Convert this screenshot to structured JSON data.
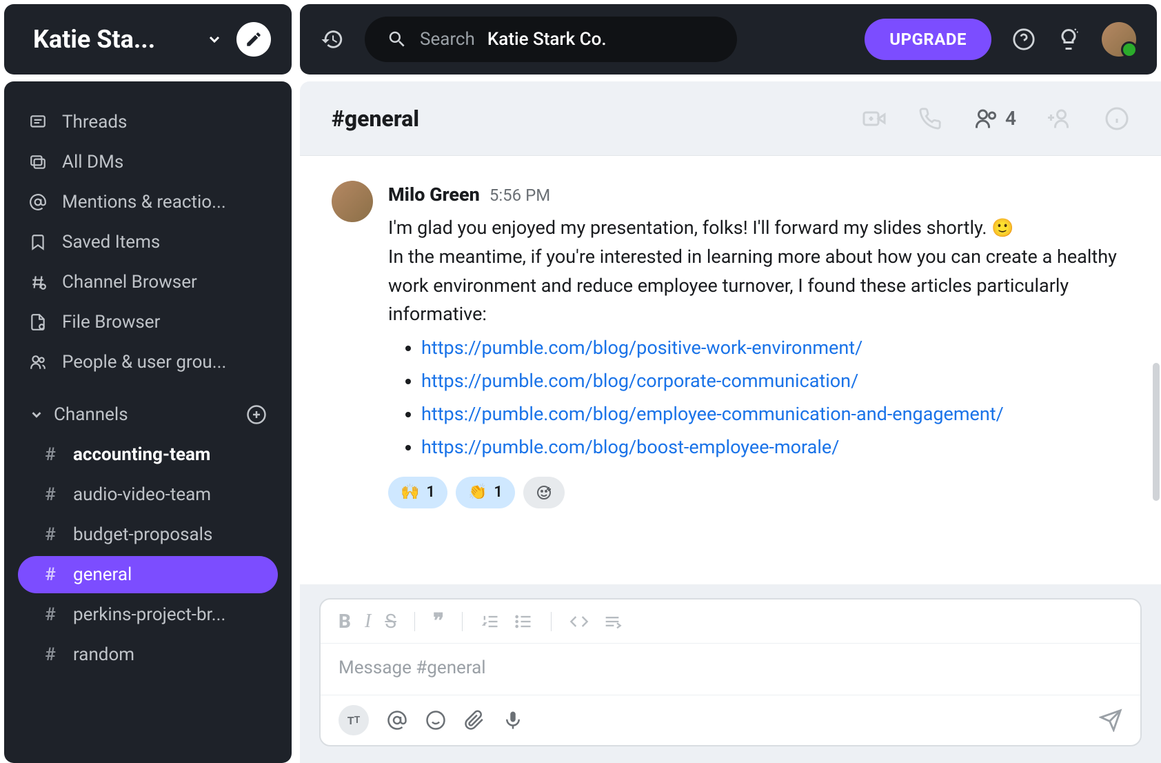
{
  "workspace": {
    "name": "Katie Sta..."
  },
  "search": {
    "label": "Search",
    "value": "Katie Stark Co."
  },
  "header": {
    "upgrade": "UPGRADE"
  },
  "nav": {
    "threads": "Threads",
    "dms": "All DMs",
    "mentions": "Mentions & reactio...",
    "saved": "Saved Items",
    "channel_browser": "Channel Browser",
    "file_browser": "File Browser",
    "people": "People & user grou..."
  },
  "channels_section": {
    "label": "Channels"
  },
  "channels": [
    {
      "name": "accounting-team",
      "bold": true
    },
    {
      "name": "audio-video-team"
    },
    {
      "name": "budget-proposals"
    },
    {
      "name": "general",
      "active": true
    },
    {
      "name": "perkins-project-br..."
    },
    {
      "name": "random"
    }
  ],
  "channel_header": {
    "title": "#general",
    "member_count": "4"
  },
  "message": {
    "author": "Milo Green",
    "time": "5:56 PM",
    "line1": "I'm glad you enjoyed my presentation, folks! I'll forward my slides shortly. ",
    "line2": "In the meantime, if you're interested in learning more about how you can create a healthy work environment and reduce employee turnover, I found these articles particularly informative:",
    "links": [
      "https://pumble.com/blog/positive-work-environment/",
      "https://pumble.com/blog/corporate-communication/",
      "https://pumble.com/blog/employee-communication-and-engagement/",
      "https://pumble.com/blog/boost-employee-morale/"
    ],
    "reactions": [
      {
        "emoji": "🙌",
        "count": "1"
      },
      {
        "emoji": "👏",
        "count": "1"
      }
    ]
  },
  "composer": {
    "placeholder": "Message #general"
  }
}
